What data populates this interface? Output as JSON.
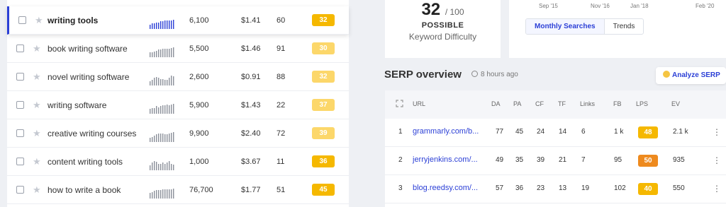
{
  "keywords": [
    {
      "kw": "writing tools",
      "vol": "6,100",
      "cpc": "$1.41",
      "pd": "60",
      "kd": "32",
      "kd_color": "#f5b800",
      "trend": [
        5,
        7,
        7,
        8,
        8,
        9,
        9,
        10,
        10,
        10,
        10,
        11
      ]
    },
    {
      "kw": "book writing software",
      "vol": "5,500",
      "cpc": "$1.46",
      "pd": "91",
      "kd": "30",
      "kd_color": "#fcd76a",
      "trend": [
        6,
        6,
        7,
        8,
        9,
        9,
        10,
        10,
        10,
        10,
        11,
        12
      ]
    },
    {
      "kw": "novel writing software",
      "vol": "2,600",
      "cpc": "$0.91",
      "pd": "88",
      "kd": "32",
      "kd_color": "#fcd76a",
      "trend": [
        5,
        7,
        9,
        10,
        9,
        8,
        8,
        7,
        7,
        9,
        12,
        11
      ]
    },
    {
      "kw": "writing software",
      "vol": "5,900",
      "cpc": "$1.43",
      "pd": "22",
      "kd": "37",
      "kd_color": "#fcd76a",
      "trend": [
        6,
        7,
        7,
        9,
        8,
        9,
        10,
        10,
        11,
        10,
        11,
        12
      ]
    },
    {
      "kw": "creative writing courses",
      "vol": "9,900",
      "cpc": "$2.40",
      "pd": "72",
      "kd": "39",
      "kd_color": "#fcd76a",
      "trend": [
        5,
        6,
        8,
        9,
        10,
        10,
        10,
        9,
        9,
        10,
        11,
        12
      ]
    },
    {
      "kw": "content writing tools",
      "vol": "1,000",
      "cpc": "$3.67",
      "pd": "11",
      "kd": "36",
      "kd_color": "#f5b800",
      "trend": [
        6,
        9,
        11,
        10,
        8,
        8,
        9,
        8,
        9,
        11,
        8,
        7
      ]
    },
    {
      "kw": "how to write a book",
      "vol": "76,700",
      "cpc": "$1.77",
      "pd": "51",
      "kd": "45",
      "kd_color": "#f5b800",
      "trend": [
        7,
        8,
        9,
        10,
        10,
        10,
        11,
        11,
        11,
        11,
        11,
        12
      ]
    }
  ],
  "kd_card": {
    "score": "32",
    "of": "/ 100",
    "possible": "POSSIBLE",
    "label": "Keyword Difficulty"
  },
  "chart_card": {
    "x_labels": [
      "Sep '15",
      "Nov '16",
      "Jan '18",
      "Feb '20"
    ],
    "tabs": [
      "Monthly Searches",
      "Trends"
    ]
  },
  "serp": {
    "title": "SERP overview",
    "time": "8 hours ago",
    "analyze_label": "Analyze SERP",
    "headers": [
      "URL",
      "DA",
      "PA",
      "CF",
      "TF",
      "Links",
      "FB",
      "LPS",
      "EV"
    ],
    "rows": [
      {
        "rank": "1",
        "url": "grammarly.com/b...",
        "da": "77",
        "pa": "45",
        "cf": "24",
        "tf": "14",
        "links": "6",
        "fb": "1 k",
        "lps": "48",
        "lps_color": "#f5b800",
        "ev": "2.1 k"
      },
      {
        "rank": "2",
        "url": "jerryjenkins.com/...",
        "da": "49",
        "pa": "35",
        "cf": "39",
        "tf": "21",
        "links": "7",
        "fb": "95",
        "lps": "50",
        "lps_color": "#ee8a1e",
        "ev": "935"
      },
      {
        "rank": "3",
        "url": "blog.reedsy.com/...",
        "da": "57",
        "pa": "36",
        "cf": "23",
        "tf": "13",
        "links": "19",
        "fb": "102",
        "lps": "40",
        "lps_color": "#f5b800",
        "ev": "550"
      }
    ]
  }
}
